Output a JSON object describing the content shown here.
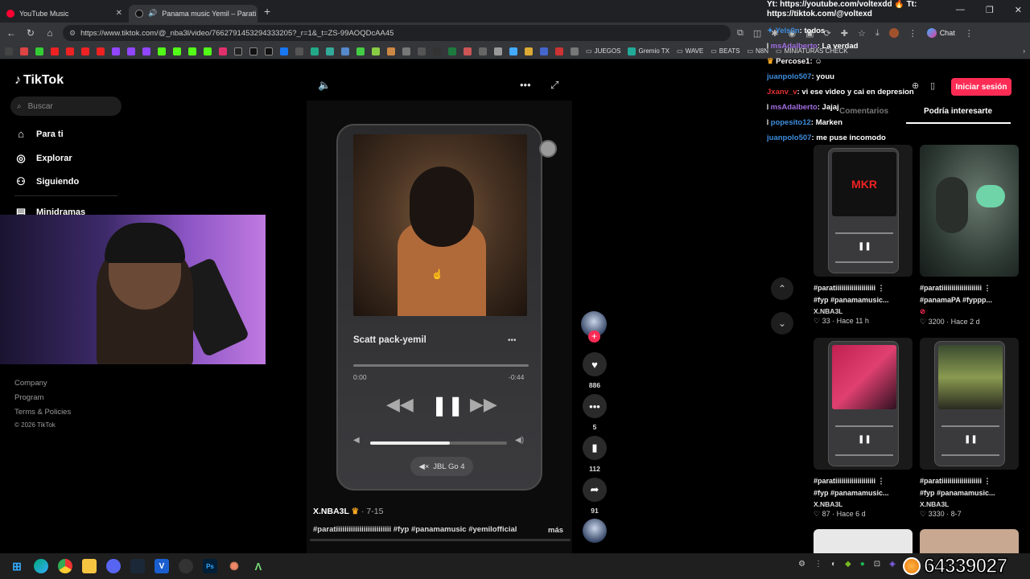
{
  "browser": {
    "tabs": [
      {
        "title": "YouTube Music",
        "color": "#ff0033"
      },
      {
        "title": "Panama music Yemil – Parati |",
        "color": "#111111"
      }
    ],
    "url": "https://www.tiktok.com/@_nba3l/video/7662791453294333205?_r=1&_t=ZS-99AOQDcAA45",
    "chat_label": "Chat",
    "bookmarks": [
      "JUEGOS",
      "Gremio TX",
      "WAVE",
      "BEATS",
      "N8N",
      "MINIATURAS CHECK"
    ]
  },
  "sidebar": {
    "logo": "TikTok",
    "search_placeholder": "Buscar",
    "nav": [
      {
        "label": "Para ti",
        "icon": "home-icon"
      },
      {
        "label": "Explorar",
        "icon": "compass-icon"
      },
      {
        "label": "Siguiendo",
        "icon": "following-icon"
      },
      {
        "label": "Minidramas",
        "icon": "minidrama-icon"
      }
    ],
    "footer": [
      "Company",
      "Program",
      "Terms & Policies",
      "© 2026 TikTok"
    ]
  },
  "player": {
    "song_title": "Scatt pack-yemil",
    "time_start": "0:00",
    "time_end": "-0:44",
    "device": "JBL Go 4",
    "volume_fraction": 0.58
  },
  "video": {
    "author": "X.NBA3L",
    "date": "· 7-15",
    "caption": "#paratiiiiiiiiiiiiiiiiiiiiiiiiii #fyp #panamamusic #yemilofficial",
    "more_label": "más",
    "likes": "886",
    "comments": "5",
    "saves": "112",
    "shares": "91"
  },
  "overlay": {
    "yt_line1": "Yt: https://youtube.com/voltexdd",
    "yt_line1_tail": "Tt:",
    "yt_line2": "https://tiktok.com/@voltexd",
    "chat": [
      {
        "user": "Yels0n",
        "text": "todos",
        "cls": "u"
      },
      {
        "user": "msAdalberto",
        "text": "La verdad",
        "cls": "u pur"
      },
      {
        "user": "Percose1",
        "text": "",
        "cls": "u"
      },
      {
        "user": "juanpolo507",
        "text": "youu",
        "cls": "u"
      },
      {
        "user": "Jxanv_v",
        "text": "vi ese video y cai en depresion",
        "cls": "u red"
      },
      {
        "user": "msAdalberto",
        "text": "Jajaj",
        "cls": "u pur"
      },
      {
        "user": "popesito12",
        "text": "Marken",
        "cls": "u"
      },
      {
        "user": "juanpolo507",
        "text": "me puse incomodo",
        "cls": "u"
      }
    ]
  },
  "right": {
    "login": "Iniciar sesión",
    "tab_comments": "Comentarios",
    "tab_suggest": "Podría interesarte",
    "cards": [
      {
        "title1": "#paratiiiiiiiiiiiiiiiiiiii",
        "title2": "#fyp #panamamusic...",
        "user": "X.NBA3L",
        "meta": "♡ 33 · Hace 11 h",
        "art": "MKR"
      },
      {
        "title1": "#paratiiiiiiiiiiiiiiiiiiii",
        "title2": "#panamaPA #fyppp...",
        "user": "",
        "meta": "♡ 3200 · Hace 2 d",
        "art": ""
      },
      {
        "title1": "#paratiiiiiiiiiiiiiiiiiiii",
        "title2": "#fyp #panamamusic...",
        "user": "X.NBA3L",
        "meta": "♡ 87 · Hace 6 d",
        "art": ""
      },
      {
        "title1": "#paratiiiiiiiiiiiiiiiiiiii",
        "title2": "#fyp #panamamusic...",
        "user": "X.NBA3L",
        "meta": "♡ 3330 · 8-7",
        "art": ""
      }
    ]
  },
  "counter": "64339027"
}
